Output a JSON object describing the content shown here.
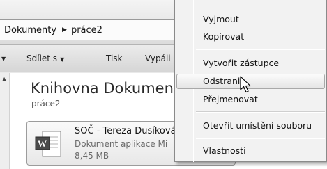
{
  "address": {
    "crumbs": [
      "Dokumenty",
      "práce2"
    ]
  },
  "toolbar": {
    "share_label": "Sdílet s",
    "print_label": "Tisk",
    "burn_label": "Vypáli"
  },
  "library": {
    "title": "Knihovna Dokument",
    "subtitle": "práce2"
  },
  "file": {
    "name": "SOČ - Tereza Dusíková",
    "type": "Dokument aplikace Mi",
    "size": "8,45 MB"
  },
  "context_menu": {
    "items": [
      "Vyjmout",
      "Kopírovat",
      "Vytvořit zástupce",
      "Odstranit",
      "Přejmenovat",
      "Otevřít umístění souboru",
      "Vlastnosti"
    ],
    "hovered": "Odstranit"
  },
  "colors": {
    "menu_background": "#f2f2f2",
    "hover_border": "#a8a8a8",
    "toolbar": "#dcdcdc",
    "content_background": "#ffffff"
  }
}
